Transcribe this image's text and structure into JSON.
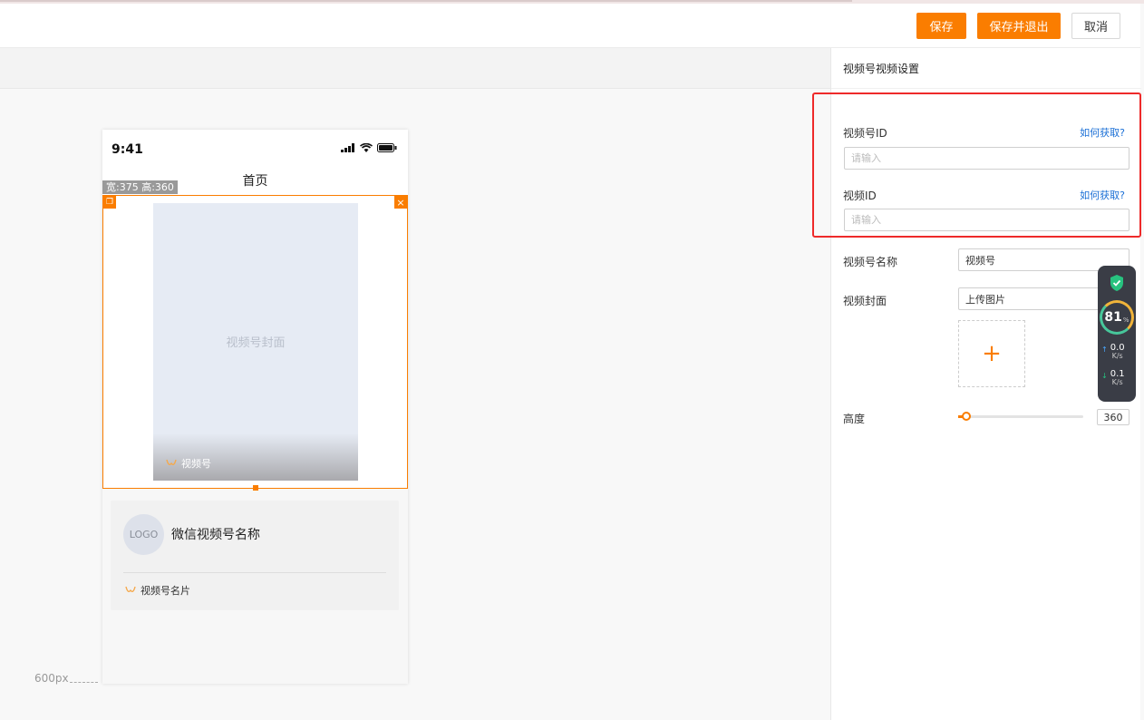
{
  "header": {
    "save_label": "保存",
    "save_exit_label": "保存并退出",
    "cancel_label": "取消"
  },
  "phone": {
    "time": "9:41",
    "nav_title": "首页",
    "size_tag": "宽:375 高:360",
    "cover_text": "视频号封面",
    "cover_channel": "视频号",
    "card": {
      "logo": "LOGO",
      "name": "微信视频号名称",
      "link": "视频号名片"
    }
  },
  "canvas": {
    "width_label": "600px"
  },
  "panel": {
    "title": "视频号视频设置",
    "channel_id_label": "视频号ID",
    "channel_id_help": "如何获取?",
    "channel_id_placeholder": "请输入",
    "video_id_label": "视频ID",
    "video_id_help": "如何获取?",
    "video_id_placeholder": "请输入",
    "channel_name_label": "视频号名称",
    "channel_name_value": "视频号",
    "cover_label": "视频封面",
    "cover_value": "上传图片",
    "upload_icon": "plus-icon",
    "height_label": "高度",
    "height_value": "360"
  },
  "widget": {
    "score": "81",
    "score_unit": "%",
    "up_value": "0.0",
    "up_unit": "K/s",
    "down_value": "0.1",
    "down_unit": "K/s"
  },
  "colors": {
    "accent": "#fa7d00",
    "highlight": "#ee2a2a",
    "link": "#1a6fd6"
  }
}
